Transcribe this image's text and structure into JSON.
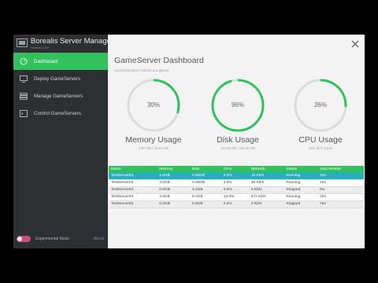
{
  "app": {
    "title": "Borealis Server Manager",
    "version": "Version 0.5.0"
  },
  "nav": [
    {
      "label": "Dashboard",
      "icon": "gauge-icon",
      "active": true
    },
    {
      "label": "Deploy GameServers",
      "icon": "monitor-icon",
      "active": false
    },
    {
      "label": "Manage GameServers",
      "icon": "server-list-icon",
      "active": false
    },
    {
      "label": "Control GameServers",
      "icon": "console-icon",
      "active": false
    }
  ],
  "footer": {
    "toggle_label": "Experimental Mode",
    "toggle_on": true,
    "about": "About"
  },
  "main": {
    "title": "GameServer Dashboard",
    "subtitle": "List performance metrics at a glance."
  },
  "gauges": [
    {
      "value": 30,
      "pct": "30%",
      "label": "Memory Usage",
      "detail": "4.97 GB / 15.91 GB"
    },
    {
      "value": 96,
      "pct": "96%",
      "label": "Disk Usage",
      "detail": "114.05 GB / 118.00 GB"
    },
    {
      "value": 26,
      "pct": "26%",
      "label": "CPU Usage",
      "detail": "26% @ 8 Cores"
    }
  ],
  "table": {
    "columns": [
      "Name",
      "Memory",
      "Disk",
      "CPU",
      "Network",
      "Status",
      "Auto-Restart"
    ],
    "rows": [
      [
        "TestServer01",
        "1.0GB",
        "0.00GB",
        "0.0%",
        "15 Kb/s",
        "Running",
        "Yes"
      ],
      [
        "TestServer02",
        "3.0GB",
        "0.00GB",
        "2.0%",
        "36 Kb/s",
        "Running",
        "Yes"
      ],
      [
        "TestServer03",
        "0.0GB",
        "3.1GB",
        "0.0%",
        "0 Kb/s",
        "Stopped",
        "No"
      ],
      [
        "TestServer04",
        "4.0GB",
        "8.2GB",
        "13.0%",
        "572 Kb/s",
        "Running",
        "Yes"
      ],
      [
        "TestServer05",
        "0.0GB",
        "5.9GB",
        "0.0%",
        "0 Kb/s",
        "Stopped",
        "Yes"
      ]
    ],
    "selected_row": 0
  },
  "colors": {
    "accent": "#32c25d",
    "sidebar": "#2d3033",
    "selected": "#29aebb",
    "track": "#dadcdb",
    "toggle": "#d24b77"
  }
}
